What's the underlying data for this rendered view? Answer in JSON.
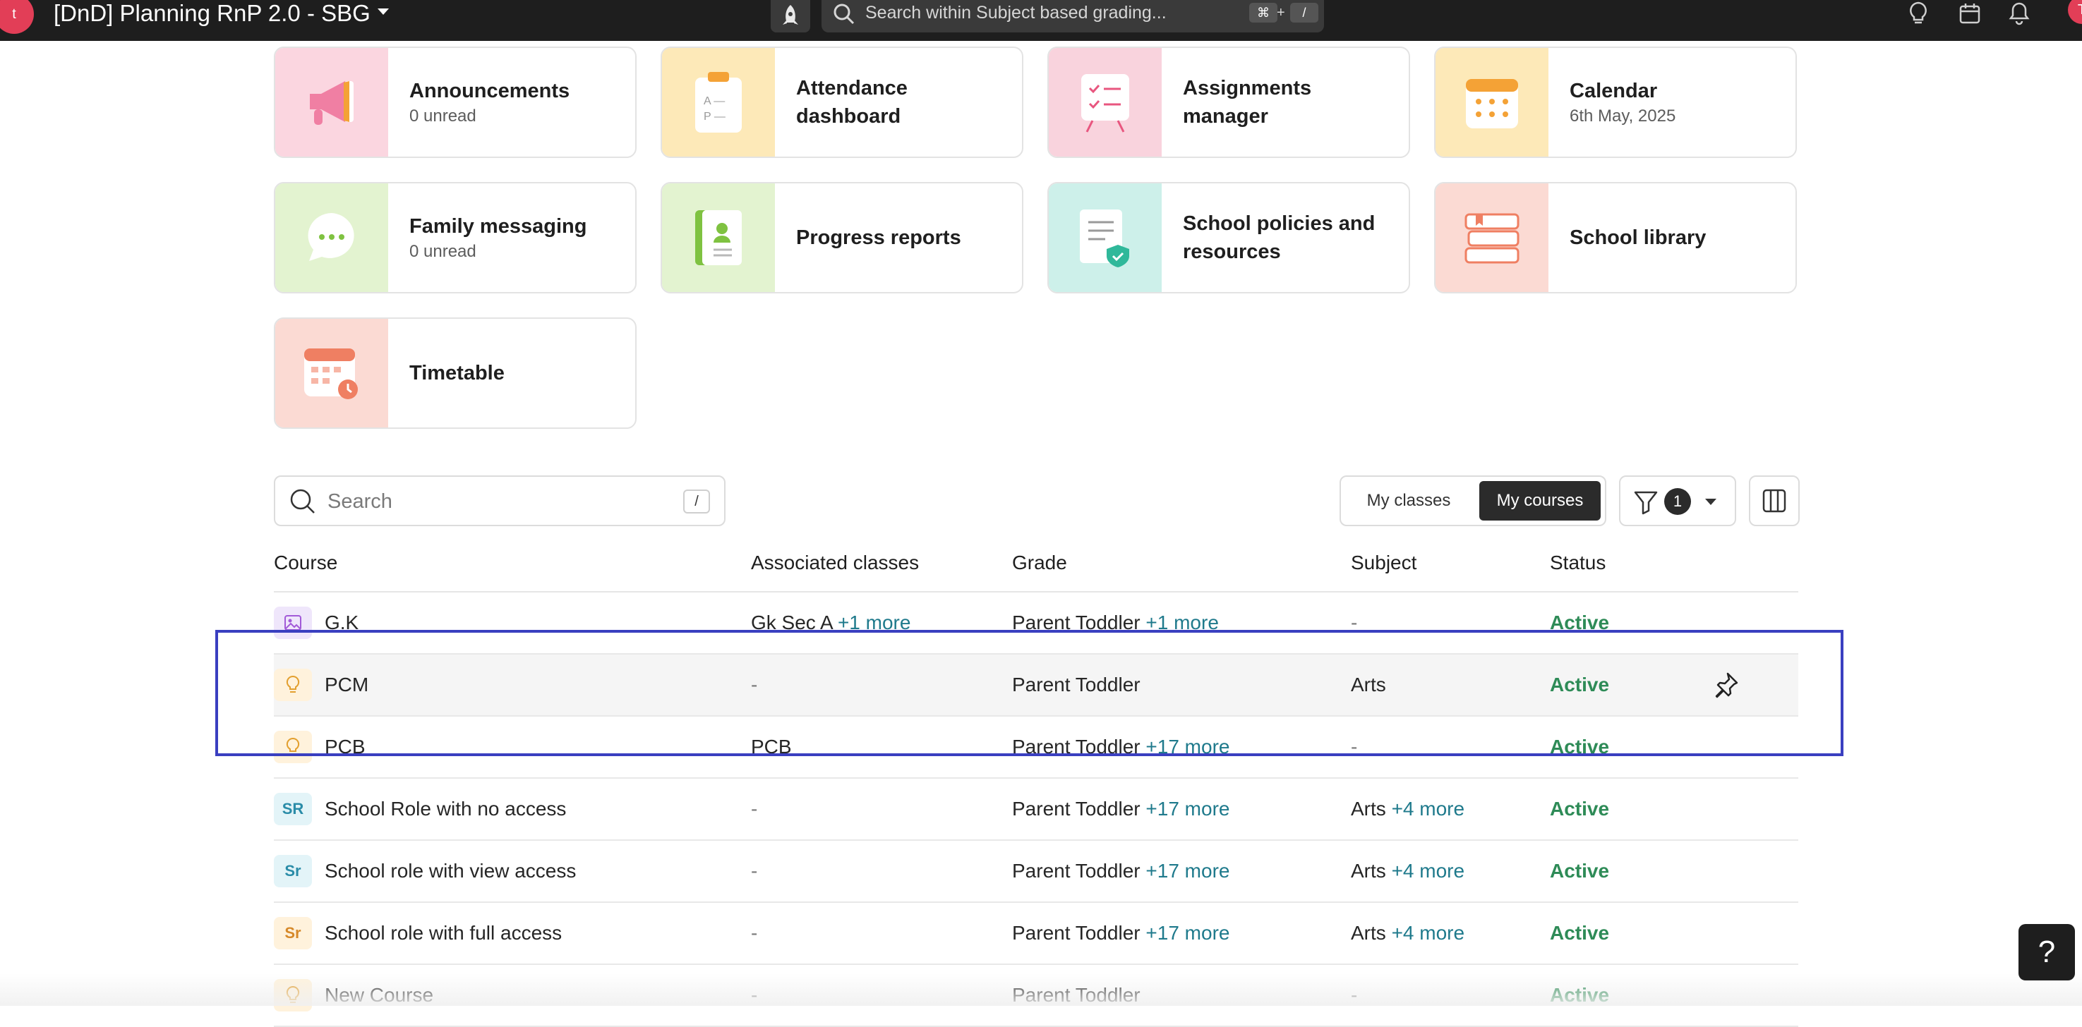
{
  "app": {
    "badge": "t",
    "title": "[DnD] Planning RnP 2.0 - SBG"
  },
  "search_global": {
    "placeholder": "Search within Subject based grading...",
    "shortcut_key1": "⌘",
    "shortcut_plus": "+",
    "shortcut_key2": "/"
  },
  "user": {
    "initial": "T"
  },
  "tiles": [
    {
      "title": "Announcements",
      "subtitle": "0 unread",
      "icon": "megaphone-icon",
      "bg": "#fbd6e0"
    },
    {
      "title": "Attendance dashboard",
      "subtitle": "",
      "icon": "clipboard-icon",
      "bg": "#fde9b8"
    },
    {
      "title": "Assignments manager",
      "subtitle": "",
      "icon": "checklist-board-icon",
      "bg": "#f9d3dd"
    },
    {
      "title": "Calendar",
      "subtitle": "6th May, 2025",
      "icon": "calendar-icon",
      "bg": "#fde9b8"
    },
    {
      "title": "Family messaging",
      "subtitle": "0 unread",
      "icon": "chat-bubble-icon",
      "bg": "#e3f3d0"
    },
    {
      "title": "Progress reports",
      "subtitle": "",
      "icon": "report-card-icon",
      "bg": "#e3f3d0"
    },
    {
      "title": "School policies and resources",
      "subtitle": "",
      "icon": "policy-document-icon",
      "bg": "#cdf0ea"
    },
    {
      "title": "School library",
      "subtitle": "",
      "icon": "books-icon",
      "bg": "#fbdad3"
    },
    {
      "title": "Timetable",
      "subtitle": "",
      "icon": "timetable-icon",
      "bg": "#fbdad3"
    }
  ],
  "toolbar": {
    "search_placeholder": "Search",
    "search_shortcut": "/",
    "toggle": {
      "option1": "My classes",
      "option2": "My courses",
      "selected": "My courses"
    },
    "filter_count": "1"
  },
  "table": {
    "headers": {
      "course": "Course",
      "classes": "Associated classes",
      "grade": "Grade",
      "subject": "Subject",
      "status": "Status"
    },
    "rows": [
      {
        "icon": "image-icon",
        "icon_text": "",
        "icon_bg": "#efe6fb",
        "icon_color": "#a25ad8",
        "course": "G.K",
        "classes": "Gk Sec A",
        "classes_more": "+1 more",
        "grade": "Parent Toddler",
        "grade_more": "+1 more",
        "subject": "-",
        "subject_more": "",
        "status": "Active"
      },
      {
        "icon": "lightbulb-icon",
        "icon_text": "",
        "icon_bg": "#fff2dc",
        "icon_color": "#e3a030",
        "course": "PCM",
        "classes": "-",
        "classes_more": "",
        "grade": "Parent Toddler",
        "grade_more": "",
        "subject": "Arts",
        "subject_more": "",
        "status": "Active"
      },
      {
        "icon": "lightbulb-icon",
        "icon_text": "",
        "icon_bg": "#fff2dc",
        "icon_color": "#e3a030",
        "course": "PCB",
        "classes": "PCB",
        "classes_more": "",
        "grade": "Parent Toddler",
        "grade_more": "+17 more",
        "subject": "-",
        "subject_more": "",
        "status": "Active"
      },
      {
        "icon": "initials-icon",
        "icon_text": "SR",
        "icon_bg": "#e3f4f8",
        "icon_color": "#2a8ca8",
        "course": "School Role with no access",
        "classes": "-",
        "classes_more": "",
        "grade": "Parent Toddler",
        "grade_more": "+17 more",
        "subject": "Arts",
        "subject_more": "+4 more",
        "status": "Active"
      },
      {
        "icon": "initials-icon",
        "icon_text": "Sr",
        "icon_bg": "#e3f4f8",
        "icon_color": "#2a8ca8",
        "course": "School role with view access",
        "classes": "-",
        "classes_more": "",
        "grade": "Parent Toddler",
        "grade_more": "+17 more",
        "subject": "Arts",
        "subject_more": "+4 more",
        "status": "Active"
      },
      {
        "icon": "initials-icon",
        "icon_text": "Sr",
        "icon_bg": "#fff2dc",
        "icon_color": "#d6892a",
        "course": "School role with full access",
        "classes": "-",
        "classes_more": "",
        "grade": "Parent Toddler",
        "grade_more": "+17 more",
        "subject": "Arts",
        "subject_more": "+4 more",
        "status": "Active"
      },
      {
        "icon": "lightbulb-icon",
        "icon_text": "",
        "icon_bg": "#fff2dc",
        "icon_color": "#e3a030",
        "course": "New Course",
        "classes": "-",
        "classes_more": "",
        "grade": "Parent Toddler",
        "grade_more": "",
        "subject": "-",
        "subject_more": "",
        "status": "Active"
      }
    ]
  },
  "help": {
    "label": "?"
  },
  "colors": {
    "accent_link": "#1f7a8c",
    "status_active": "#2e8b57",
    "selection": "#3a3fc0",
    "topbar": "#1e1e1e"
  }
}
